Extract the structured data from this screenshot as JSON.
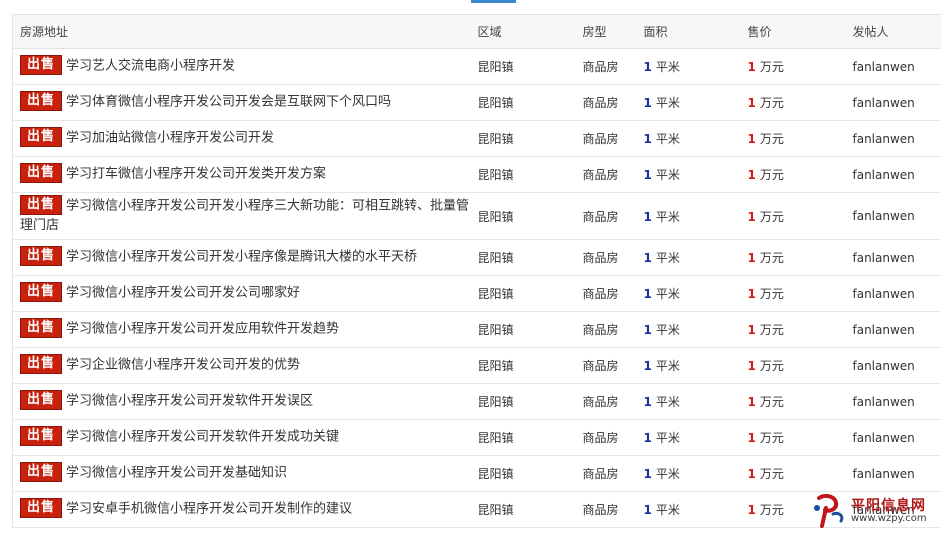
{
  "header": {
    "col_address": "房源地址",
    "col_region": "区域",
    "col_type": "房型",
    "col_area": "面积",
    "col_price": "售价",
    "col_poster": "发帖人"
  },
  "badge_label": "出售",
  "area_unit": "平米",
  "price_unit": "万元",
  "rows": [
    {
      "title": "学习艺人交流电商小程序开发",
      "region": "昆阳镇",
      "type": "商品房",
      "area": "1",
      "price": "1",
      "poster": "fanlanwen"
    },
    {
      "title": "学习体育微信小程序开发公司开发会是互联网下个风口吗",
      "region": "昆阳镇",
      "type": "商品房",
      "area": "1",
      "price": "1",
      "poster": "fanlanwen"
    },
    {
      "title": "学习加油站微信小程序开发公司开发",
      "region": "昆阳镇",
      "type": "商品房",
      "area": "1",
      "price": "1",
      "poster": "fanlanwen"
    },
    {
      "title": "学习打车微信小程序开发公司开发类开发方案",
      "region": "昆阳镇",
      "type": "商品房",
      "area": "1",
      "price": "1",
      "poster": "fanlanwen"
    },
    {
      "title": "学习微信小程序开发公司开发小程序三大新功能：可相互跳转、批量管理门店",
      "region": "昆阳镇",
      "type": "商品房",
      "area": "1",
      "price": "1",
      "poster": "fanlanwen"
    },
    {
      "title": "学习微信小程序开发公司开发小程序像是腾讯大楼的水平天桥",
      "region": "昆阳镇",
      "type": "商品房",
      "area": "1",
      "price": "1",
      "poster": "fanlanwen"
    },
    {
      "title": "学习微信小程序开发公司开发公司哪家好",
      "region": "昆阳镇",
      "type": "商品房",
      "area": "1",
      "price": "1",
      "poster": "fanlanwen"
    },
    {
      "title": "学习微信小程序开发公司开发应用软件开发趋势",
      "region": "昆阳镇",
      "type": "商品房",
      "area": "1",
      "price": "1",
      "poster": "fanlanwen"
    },
    {
      "title": "学习企业微信小程序开发公司开发的优势",
      "region": "昆阳镇",
      "type": "商品房",
      "area": "1",
      "price": "1",
      "poster": "fanlanwen"
    },
    {
      "title": "学习微信小程序开发公司开发软件开发误区",
      "region": "昆阳镇",
      "type": "商品房",
      "area": "1",
      "price": "1",
      "poster": "fanlanwen"
    },
    {
      "title": "学习微信小程序开发公司开发软件开发成功关键",
      "region": "昆阳镇",
      "type": "商品房",
      "area": "1",
      "price": "1",
      "poster": "fanlanwen"
    },
    {
      "title": "学习微信小程序开发公司开发基础知识",
      "region": "昆阳镇",
      "type": "商品房",
      "area": "1",
      "price": "1",
      "poster": "fanlanwen"
    },
    {
      "title": "学习安卓手机微信小程序开发公司开发制作的建议",
      "region": "昆阳镇",
      "type": "商品房",
      "area": "1",
      "price": "1",
      "poster": "fanlanwen"
    }
  ],
  "watermark": {
    "name": "平阳信息网",
    "url": "www.wzpy.com"
  },
  "colors": {
    "badge": "#c8220f",
    "area_number": "#1a2fa0",
    "price_number": "#d41b1b",
    "tab_accent": "#3a86c8"
  }
}
